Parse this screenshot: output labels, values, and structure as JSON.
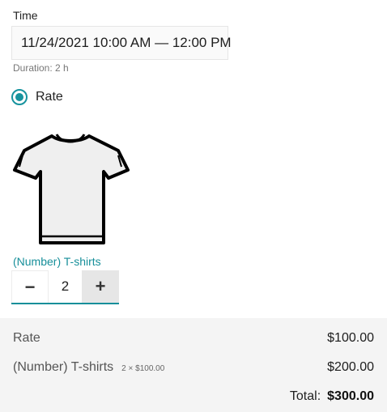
{
  "time": {
    "label": "Time",
    "value": "11/24/2021 10:00 AM — 12:00 PM",
    "duration": "Duration: 2 h"
  },
  "rate_option": {
    "label": "Rate",
    "selected": true
  },
  "item": {
    "image": "t-shirt-icon",
    "name": "(Number) T-shirts",
    "quantity": "2",
    "decrement_label": "−",
    "increment_label": "+"
  },
  "summary": {
    "rate_label": "Rate",
    "rate_amount": "$100.00",
    "item_label": "(Number) T-shirts",
    "item_detail": "2 × $100.00",
    "item_amount": "$200.00",
    "total_label": "Total:",
    "total_amount": "$300.00"
  },
  "colors": {
    "accent": "#17939e"
  }
}
